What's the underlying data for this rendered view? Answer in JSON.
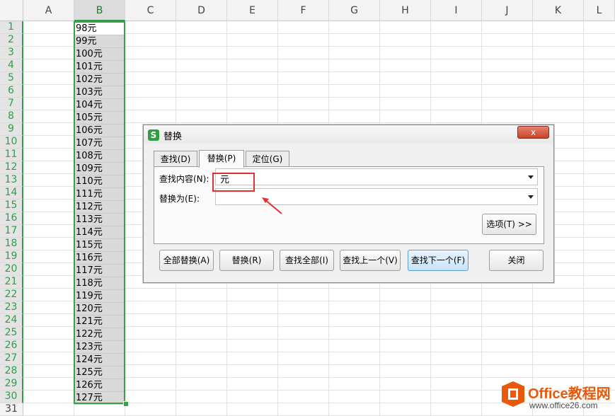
{
  "sheet": {
    "columns": [
      "A",
      "B",
      "C",
      "D",
      "E",
      "F",
      "G",
      "H",
      "I",
      "J",
      "K",
      "L"
    ],
    "selected_column": "B",
    "rows": [
      "1",
      "2",
      "3",
      "4",
      "5",
      "6",
      "7",
      "8",
      "9",
      "10",
      "11",
      "12",
      "13",
      "14",
      "15",
      "16",
      "17",
      "18",
      "19",
      "20",
      "21",
      "22",
      "23",
      "24",
      "25",
      "26",
      "27",
      "28",
      "29",
      "30",
      "31"
    ],
    "column_b_values": [
      "98元",
      "99元",
      "100元",
      "101元",
      "102元",
      "103元",
      "104元",
      "105元",
      "106元",
      "107元",
      "108元",
      "109元",
      "110元",
      "111元",
      "112元",
      "113元",
      "114元",
      "115元",
      "116元",
      "117元",
      "118元",
      "119元",
      "120元",
      "121元",
      "122元",
      "123元",
      "124元",
      "125元",
      "126元",
      "127元"
    ]
  },
  "dialog": {
    "app_icon": "S",
    "title": "替换",
    "close": "x",
    "tabs": [
      {
        "label": "查找(D)",
        "active": false
      },
      {
        "label": "替换(P)",
        "active": true
      },
      {
        "label": "定位(G)",
        "active": false
      }
    ],
    "find_label": "查找内容(N):",
    "find_value": "元",
    "replace_label": "替换为(E):",
    "replace_value": "",
    "options_label": "选项(T) >>",
    "buttons": {
      "replace_all": "全部替换(A)",
      "replace": "替换(R)",
      "find_all": "查找全部(I)",
      "find_prev": "查找上一个(V)",
      "find_next": "查找下一个(F)",
      "close": "关闭"
    }
  },
  "watermark": {
    "brand": "Office教程网",
    "url": "www.office26.com"
  },
  "colors": {
    "selection_green": "#3aa04a",
    "highlight_red": "#e53030",
    "brand_orange": "#e8590c"
  }
}
